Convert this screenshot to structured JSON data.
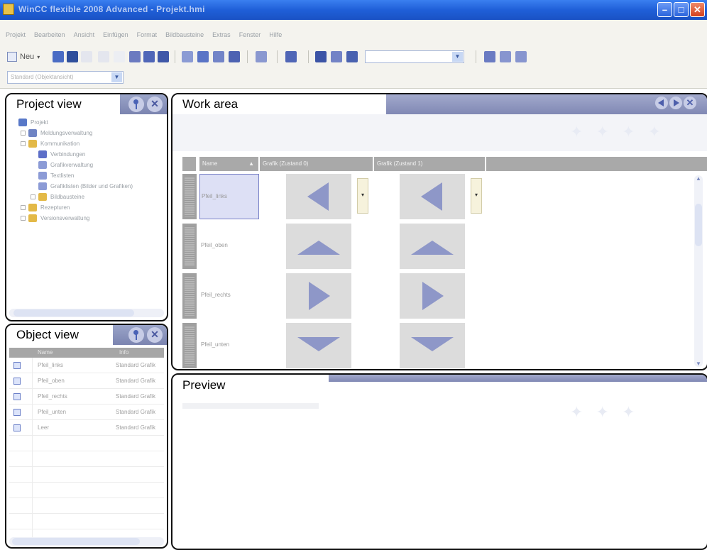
{
  "window": {
    "title": "WinCC flexible 2008 Advanced - Projekt.hmi",
    "minimize_glyph": "–",
    "maximize_glyph": "□",
    "close_glyph": "✕"
  },
  "menu": {
    "items": [
      "Projekt",
      "Bearbeiten",
      "Ansicht",
      "Einfügen",
      "Format",
      "Bildbausteine",
      "Extras",
      "Fenster",
      "Hilfe"
    ]
  },
  "toolbar": {
    "new_label": "Neu",
    "font_dropdown_value": "",
    "object_dropdown_value": "Standard (Objektansicht)"
  },
  "project_view": {
    "title": "Project view",
    "tree": [
      {
        "label": "Projekt",
        "level": 0,
        "expander": "",
        "icon_color": "#5878c8"
      },
      {
        "label": "Meldungsverwaltung",
        "level": 1,
        "expander": "+",
        "icon_color": "#6f84c4"
      },
      {
        "label": "Kommunikation",
        "level": 1,
        "expander": "-",
        "icon_color": "#e3b947"
      },
      {
        "label": "Verbindungen",
        "level": 2,
        "expander": "",
        "icon_color": "#5d6fc8"
      },
      {
        "label": "Grafikverwaltung",
        "level": 2,
        "expander": "",
        "icon_color": "#8c9bd6"
      },
      {
        "label": "Textlisten",
        "level": 2,
        "expander": "",
        "icon_color": "#8c9bd6"
      },
      {
        "label": "Grafiklisten (Bilder und Grafiken)",
        "level": 2,
        "expander": "",
        "icon_color": "#8c9bd6"
      },
      {
        "label": "Bildbausteine",
        "level": 2,
        "expander": "+",
        "icon_color": "#e3b947"
      },
      {
        "label": "Rezepturen",
        "level": 1,
        "expander": "+",
        "icon_color": "#e3b947"
      },
      {
        "label": "Versionsverwaltung",
        "level": 1,
        "expander": "+",
        "icon_color": "#e3b947"
      }
    ]
  },
  "object_view": {
    "title": "Object view",
    "columns": [
      "",
      "Name",
      "Info"
    ],
    "rows": [
      {
        "name": "Pfeil_links",
        "info": "Standard Grafik"
      },
      {
        "name": "Pfeil_oben",
        "info": "Standard Grafik"
      },
      {
        "name": "Pfeil_rechts",
        "info": "Standard Grafik"
      },
      {
        "name": "Pfeil_unten",
        "info": "Standard Grafik"
      },
      {
        "name": "Leer",
        "info": "Standard Grafik"
      }
    ]
  },
  "work_area": {
    "title": "Work area",
    "columns": [
      "Name",
      "Grafik (Zustand 0)",
      "Grafik (Zustand 1)"
    ],
    "rows": [
      {
        "name": "Pfeil_links",
        "direction": "left"
      },
      {
        "name": "Pfeil_oben",
        "direction": "up"
      },
      {
        "name": "Pfeil_rechts",
        "direction": "right"
      },
      {
        "name": "Pfeil_unten",
        "direction": "down"
      }
    ],
    "dropdown_glyph": "▾"
  },
  "preview": {
    "title": "Preview"
  },
  "colors": {
    "titlebar": "#2a64d6",
    "panel_header": "#7b84b0",
    "arrow_fill": "#8e97c8",
    "selection": "#dde0f5"
  }
}
